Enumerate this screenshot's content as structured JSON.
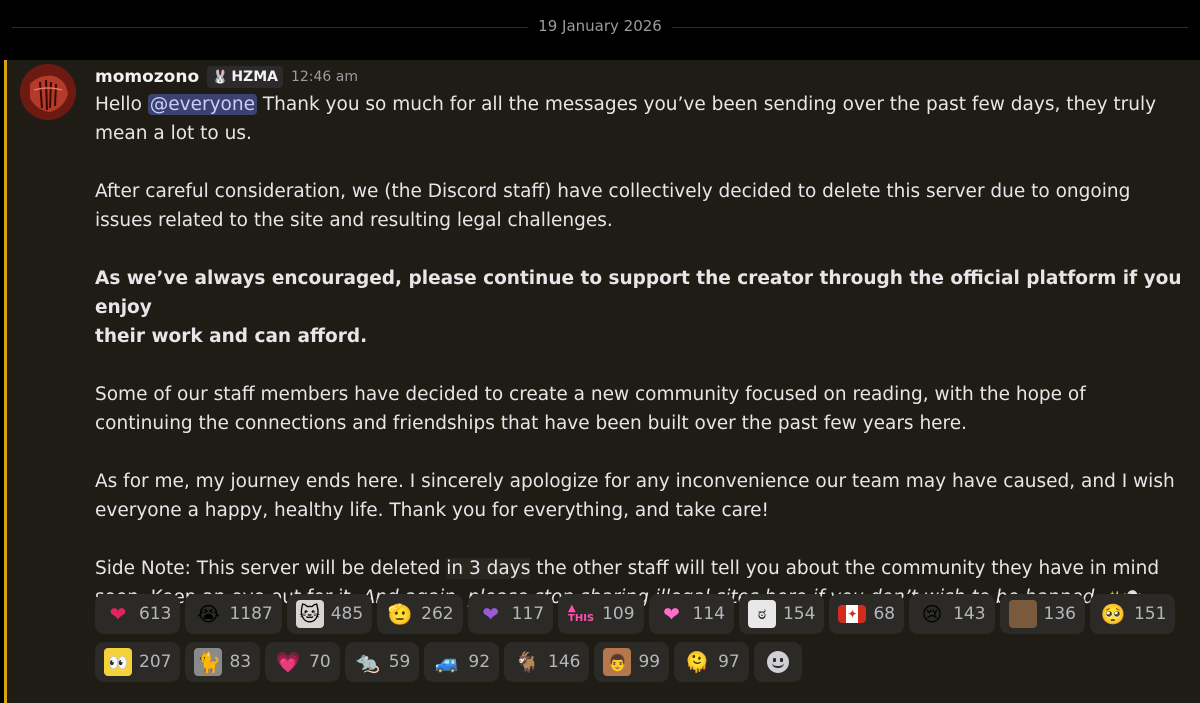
{
  "divider": {
    "date": "19 January 2026"
  },
  "message": {
    "username": "momozono",
    "role_tag": "HZMA",
    "timestamp": "12:46 am",
    "accent_color": "#d6a315",
    "p1_greeting": "Hello ",
    "p1_mention": "@everyone",
    "p1_text_line1": " Thank you so much for all the messages you’ve been sending over the past few days,  they truly",
    "p1_text_line2": "mean a lot to us.",
    "p2_line1": "After careful consideration, we (the Discord staff) have collectively decided to delete this server due to ongoing",
    "p2_line2": "issues related to the site and resulting legal challenges.",
    "p3_line1": "As we’ve always encouraged, please continue to support the creator through the official platform if you enjoy",
    "p3_line2": "their work and can afford.",
    "p4_line1": "Some of our staff members have decided to create a new community focused on reading, with the hope of",
    "p4_line2": "continuing the connections and friendships that have been built over the past few years here.",
    "p5_line1": "As for me, my journey ends here. I sincerely apologize for any inconvenience our team may have caused, and I wish",
    "p5_line2": "everyone a happy, healthy life. Thank you for everything, and take care!",
    "p6_part1": "Side Note: This server will be deleted ",
    "p6_highlight": "in 3 days",
    "p6_part2": " the other staff will tell you about the community they have in mind",
    "p6_line2_regular": "soon. Keep an eye out for it. ",
    "p6_line2_italic": "And again, please stop sharing illegal sites here if you don’t wish to be banned."
  },
  "reactions": [
    {
      "icon": "red-heart-icon",
      "count": "613"
    },
    {
      "icon": "loudly-crying-face-icon",
      "count": "1187"
    },
    {
      "icon": "white-cat-icon",
      "count": "485"
    },
    {
      "icon": "saluting-hand-icon",
      "count": "262"
    },
    {
      "icon": "purple-heart-icon",
      "count": "117"
    },
    {
      "icon": "this-arrow-icon",
      "count": "109"
    },
    {
      "icon": "pink-heart-icon",
      "count": "114"
    },
    {
      "icon": "meme-face-icon",
      "count": "154"
    },
    {
      "icon": "canada-flag-icon",
      "count": "68"
    },
    {
      "icon": "crying-blue-blob-icon",
      "count": "143"
    },
    {
      "icon": "brown-creature-icon",
      "count": "136"
    },
    {
      "icon": "red-pleading-icon",
      "count": "151"
    },
    {
      "icon": "sponge-eyes-icon",
      "count": "207"
    },
    {
      "icon": "gray-cat-icon",
      "count": "83"
    },
    {
      "icon": "sparkling-heart-icon",
      "count": "70"
    },
    {
      "icon": "rat-icon",
      "count": "59"
    },
    {
      "icon": "blue-car-icon",
      "count": "92"
    },
    {
      "icon": "white-goat-icon",
      "count": "146"
    },
    {
      "icon": "man-portrait-icon",
      "count": "99"
    },
    {
      "icon": "blue-blob-icon",
      "count": "97"
    }
  ]
}
